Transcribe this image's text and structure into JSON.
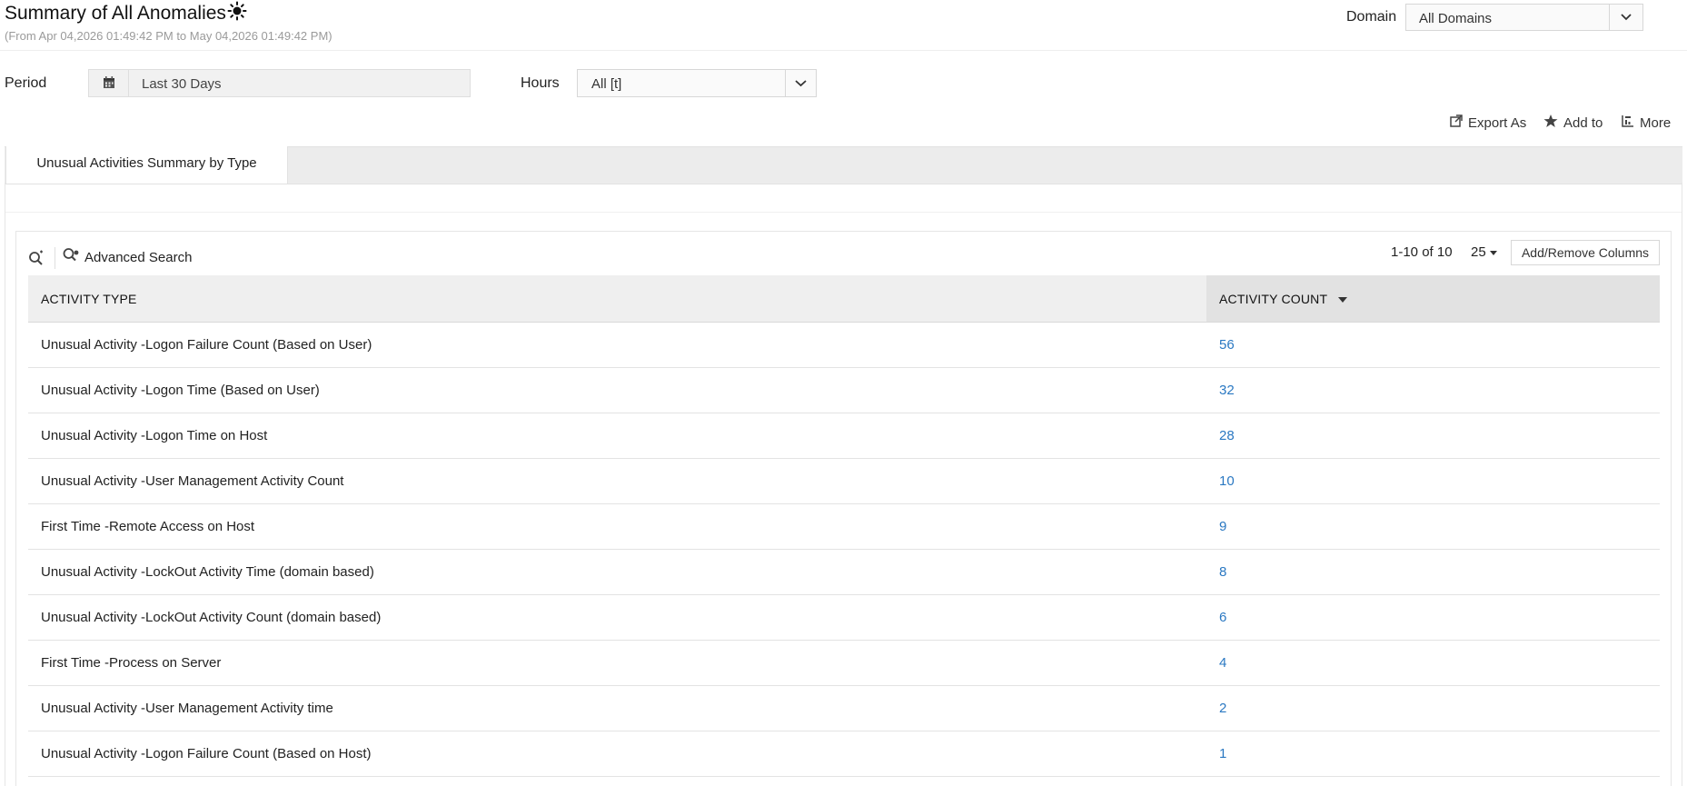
{
  "header": {
    "title": "Summary of All Anomalies",
    "subtitle": "(From Apr 04,2026 01:49:42 PM to May 04,2026 01:49:42 PM)",
    "domain_label": "Domain",
    "domain_value": "All Domains"
  },
  "filters": {
    "period_label": "Period",
    "period_value": "Last 30 Days",
    "hours_label": "Hours",
    "hours_value": "All [t]"
  },
  "actions": {
    "export_label": "Export As",
    "add_label": "Add to",
    "more_label": "More"
  },
  "tabs": [
    {
      "label": "Unusual Activities Summary by Type",
      "active": true
    }
  ],
  "grid": {
    "advanced_search_label": "Advanced Search",
    "pager_text": "1-10 of 10",
    "page_size": "25",
    "add_remove_columns_label": "Add/Remove Columns",
    "columns": [
      "ACTIVITY TYPE",
      "ACTIVITY COUNT"
    ],
    "sorted_column": "ACTIVITY COUNT",
    "rows": [
      {
        "type": "Unusual Activity -Logon Failure Count (Based on User)",
        "count": "56"
      },
      {
        "type": "Unusual Activity -Logon Time (Based on User)",
        "count": "32"
      },
      {
        "type": "Unusual Activity -Logon Time on Host",
        "count": "28"
      },
      {
        "type": "Unusual Activity -User Management Activity Count",
        "count": "10"
      },
      {
        "type": "First Time -Remote Access on Host",
        "count": "9"
      },
      {
        "type": "Unusual Activity -LockOut Activity Time (domain based)",
        "count": "8"
      },
      {
        "type": "Unusual Activity -LockOut Activity Count (domain based)",
        "count": "6"
      },
      {
        "type": "First Time -Process on Server",
        "count": "4"
      },
      {
        "type": "Unusual Activity -User Management Activity time",
        "count": "2"
      },
      {
        "type": "Unusual Activity -Logon Failure Count (Based on Host)",
        "count": "1"
      }
    ]
  },
  "icons": {
    "theme": "sun-icon",
    "calendar": "calendar-icon",
    "dropdown": "chevron-down-icon",
    "export": "export-icon",
    "add": "star-icon",
    "more": "more-icon",
    "search": "search-icon",
    "advanced_search": "advanced-search-icon"
  },
  "colors": {
    "link": "#2a78c2",
    "tab_bar": "#ececec",
    "header_row": "#efefef",
    "sorted_header": "#e2e2e2"
  }
}
